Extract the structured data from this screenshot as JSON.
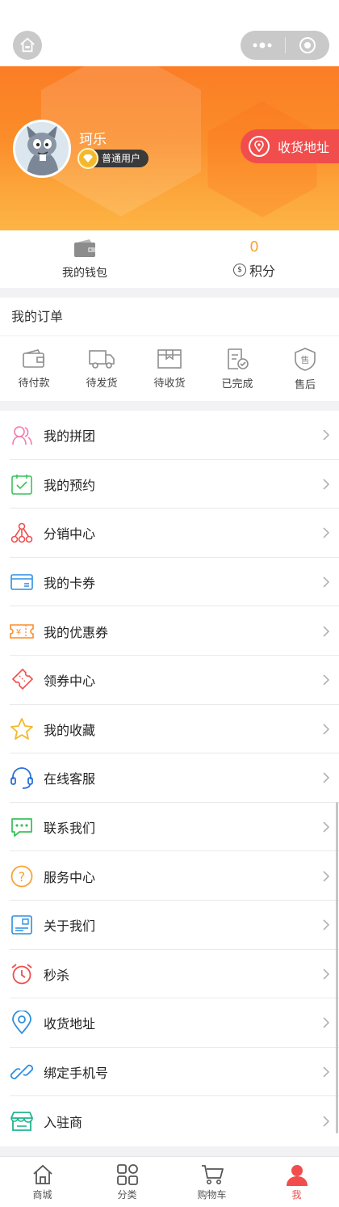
{
  "colors": {
    "accent": "#f14d4d",
    "orange": "#fb8d2a",
    "points": "#fba234"
  },
  "window": {
    "home_icon": "home-icon",
    "more_icon": "more-dots-icon",
    "close_icon": "target-icon"
  },
  "profile": {
    "username": "珂乐",
    "level": "普通用户",
    "address_button": "收货地址"
  },
  "stats": {
    "wallet_label": "我的钱包",
    "points_value": "0",
    "points_label": "积分",
    "points_coin": "$"
  },
  "orders": {
    "title": "我的订单",
    "items": [
      {
        "label": "待付款",
        "icon": "wallet-icon"
      },
      {
        "label": "待发货",
        "icon": "truck-icon"
      },
      {
        "label": "待收货",
        "icon": "box-icon"
      },
      {
        "label": "已完成",
        "icon": "done-doc-icon"
      },
      {
        "label": "售后",
        "icon": "after-sale-icon"
      }
    ]
  },
  "menu": {
    "items": [
      {
        "label": "我的拼团",
        "icon": "group-buy-icon",
        "color": "#f27ab0"
      },
      {
        "label": "我的预约",
        "icon": "calendar-check-icon",
        "color": "#3cc15a"
      },
      {
        "label": "分销中心",
        "icon": "distribution-icon",
        "color": "#f14d4d"
      },
      {
        "label": "我的卡券",
        "icon": "card-icon",
        "color": "#2d8fe0"
      },
      {
        "label": "我的优惠券",
        "icon": "coupon-icon",
        "color": "#fb8d2a"
      },
      {
        "label": "领券中心",
        "icon": "ticket-icon",
        "color": "#f14d4d"
      },
      {
        "label": "我的收藏",
        "icon": "star-icon",
        "color": "#f4b82a"
      },
      {
        "label": "在线客服",
        "icon": "headset-icon",
        "color": "#2a6fd6"
      },
      {
        "label": "联系我们",
        "icon": "chat-icon",
        "color": "#3cc15a"
      },
      {
        "label": "服务中心",
        "icon": "question-icon",
        "color": "#fba234"
      },
      {
        "label": "关于我们",
        "icon": "about-card-icon",
        "color": "#2d8fe0"
      },
      {
        "label": "秒杀",
        "icon": "alarm-icon",
        "color": "#f14d4d"
      },
      {
        "label": "收货地址",
        "icon": "location-icon",
        "color": "#2d8fe0"
      },
      {
        "label": "绑定手机号",
        "icon": "link-icon",
        "color": "#2d8fe0"
      },
      {
        "label": "入驻商",
        "icon": "store-icon",
        "color": "#22b58f"
      }
    ]
  },
  "tabbar": {
    "items": [
      {
        "label": "商城",
        "icon": "shop-home-icon",
        "active": false
      },
      {
        "label": "分类",
        "icon": "category-icon",
        "active": false
      },
      {
        "label": "购物车",
        "icon": "cart-icon",
        "active": false
      },
      {
        "label": "我",
        "icon": "user-icon",
        "active": true
      }
    ]
  }
}
